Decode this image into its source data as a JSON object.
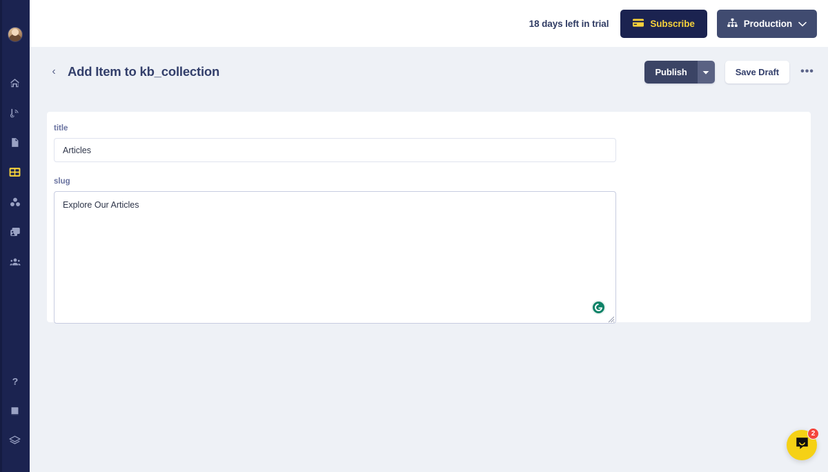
{
  "sidebar": {
    "avatar_name": "user-avatar",
    "top_items": [
      {
        "name": "home-icon",
        "label": "Home",
        "active": false
      },
      {
        "name": "broadcast-icon",
        "label": "Broadcasts",
        "active": false
      },
      {
        "name": "document-icon",
        "label": "Pages",
        "active": false
      },
      {
        "name": "grid-table-icon",
        "label": "Collections",
        "active": true
      },
      {
        "name": "blocks-icon",
        "label": "Components",
        "active": false
      },
      {
        "name": "media-image-icon",
        "label": "Media",
        "active": false
      },
      {
        "name": "users-icon",
        "label": "Users",
        "active": false
      }
    ],
    "bottom_items": [
      {
        "name": "help-question-icon",
        "label": "Help"
      },
      {
        "name": "book-icon",
        "label": "Docs"
      },
      {
        "name": "layers-stack-icon",
        "label": "Layers"
      }
    ]
  },
  "topbar": {
    "trial_text": "18 days left in trial",
    "subscribe_label": "Subscribe",
    "environment_label": "Production"
  },
  "page_header": {
    "back_glyph": "‹",
    "title": "Add Item to kb_collection",
    "publish_label": "Publish",
    "save_draft_label": "Save Draft",
    "more_glyph": "•••"
  },
  "form": {
    "fields": [
      {
        "label": "title",
        "value": "Articles",
        "placeholder": "",
        "type": "text"
      },
      {
        "label": "slug",
        "value": "Explore Our Articles",
        "placeholder": "",
        "type": "textarea"
      }
    ]
  },
  "widgets": {
    "grammarly_letter": "G",
    "intercom_badge_count": "2"
  },
  "colors": {
    "sidebar_bg": "#1b2350",
    "accent_yellow": "#f5d13b",
    "page_bg": "#eef1f6",
    "card_bg": "#ffffff",
    "title_text": "#333f6b",
    "env_button_bg": "#404b70",
    "publish_bg": "#3b4465",
    "grammarly_green": "#0d8267",
    "intercom_yellow": "#f5d115",
    "badge_red": "#f4463c"
  }
}
